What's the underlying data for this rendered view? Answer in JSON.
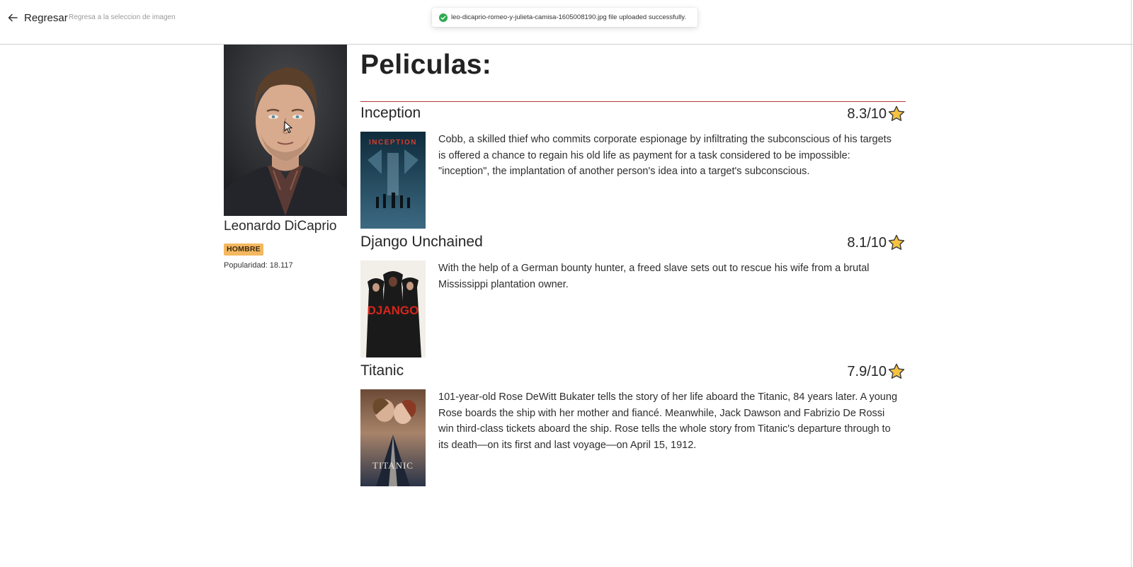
{
  "header": {
    "back_label": "Regresar",
    "back_subtitle": "Regresa a la seleccion de imagen",
    "toast_message": "leo-dicaprio-romeo-y-julieta-camisa-1605008190.jpg file uploaded successfully."
  },
  "actor": {
    "name": "Leonardo DiCaprio",
    "gender": "HOMBRE",
    "popularity_label": "Popularidad:",
    "popularity_value": "18.117"
  },
  "movies_title": "Peliculas:",
  "movies": [
    {
      "title": "Inception",
      "rating": "8.3/10",
      "overview": "Cobb, a skilled thief who commits corporate espionage by infiltrating the subconscious of his targets is offered a chance to regain his old life as payment for a task considered to be impossible: \"inception\", the implantation of another person's idea into a target's subconscious.",
      "poster_text": "INCEPTION"
    },
    {
      "title": "Django Unchained",
      "rating": "8.1/10",
      "overview": "With the help of a German bounty hunter, a freed slave sets out to rescue his wife from a brutal Mississippi plantation owner.",
      "poster_text": "DJANGO"
    },
    {
      "title": "Titanic",
      "rating": "7.9/10",
      "overview": "101-year-old Rose DeWitt Bukater tells the story of her life aboard the Titanic, 84 years later. A young Rose boards the ship with her mother and fiancé. Meanwhile, Jack Dawson and Fabrizio De Rossi win third-class tickets aboard the ship. Rose tells the whole story from Titanic's departure through to its death—on its first and last voyage—on April 15, 1912.",
      "poster_text": "TITANIC"
    }
  ],
  "colors": {
    "accent_rule": "#b33a3a",
    "badge": "#f4b860",
    "star": "#f5c242",
    "success": "#2eaa4f"
  },
  "icons": [
    "arrow-left-icon",
    "check-circle-icon",
    "star-icon",
    "mouse-cursor-icon"
  ]
}
